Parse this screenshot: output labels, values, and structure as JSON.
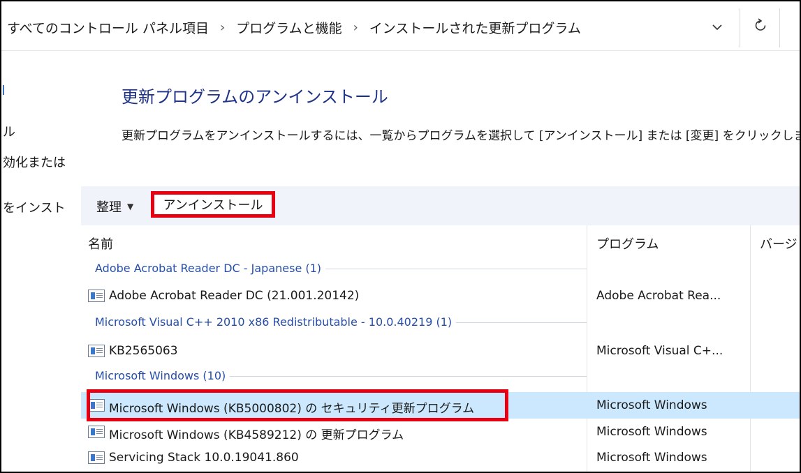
{
  "address_bar": {
    "breadcrumbs": [
      "すべてのコントロール パネル項目",
      "プログラムと機能",
      "インストールされた更新プログラム"
    ],
    "separator": "›",
    "dropdown_icon": "chevron-down-icon",
    "refresh_icon": "refresh-icon"
  },
  "left_nav": {
    "fragments": [
      "ル",
      "効化または",
      "をインスト"
    ]
  },
  "page": {
    "title": "更新プログラムのアンインストール",
    "description": "更新プログラムをアンインストールするには、一覧からプログラムを選択して [アンインストール] または [変更] をクリックしま"
  },
  "toolbar": {
    "organize_label": "整理",
    "organize_caret": "▼",
    "uninstall_label": "アンインストール"
  },
  "list": {
    "columns": [
      "名前",
      "プログラム",
      "バージョ"
    ],
    "groups": [
      {
        "label": "Adobe Acrobat Reader DC - Japanese (1)",
        "items": [
          {
            "name": "Adobe Acrobat Reader DC  (21.001.20142)",
            "program": "Adobe Acrobat Rea...",
            "selected": false
          }
        ]
      },
      {
        "label": "Microsoft Visual C++ 2010  x86 Redistributable - 10.0.40219 (1)",
        "items": [
          {
            "name": "KB2565063",
            "program": "Microsoft Visual C+...",
            "selected": false
          }
        ]
      },
      {
        "label": "Microsoft Windows (10)",
        "items": [
          {
            "name": "Microsoft Windows (KB5000802) の セキュリティ更新プログラム",
            "program": "Microsoft Windows",
            "selected": true
          },
          {
            "name": "Microsoft Windows (KB4589212) の 更新プログラム",
            "program": "Microsoft Windows",
            "selected": false
          },
          {
            "name": "Servicing Stack 10.0.19041.860",
            "program": "Microsoft Windows",
            "selected": false
          }
        ]
      }
    ]
  },
  "colors": {
    "accent_title": "#1e3287",
    "group_label": "#264ea8",
    "toolbar_bg": "#f0f3f9",
    "selection_bg": "#cce8ff",
    "highlight_red": "#e60012"
  }
}
